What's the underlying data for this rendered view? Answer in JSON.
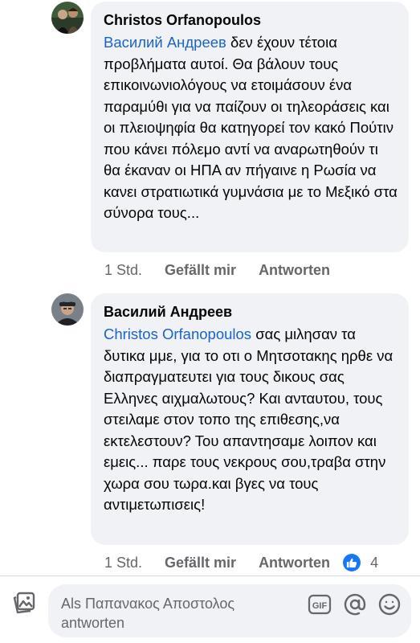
{
  "comments": [
    {
      "author": "Christos Orfanopoulos",
      "mention": "Василий Андреев",
      "text": " δεν έχουν τέτοια προβλήματα αυτοί.  Θα βάλουν τους επικοινωνιολόγους να ετοιμάσουν ένα παραμύθι για να παίζουν οι τηλεοράσεις και οι πλειοψηφία θα κατηγορεί τον κακό Πούτιν που κάνει πόλεμο αντί να αναρωτηθούν τι θα έκαναν οι ΗΠΑ αν πήγαινε η Ρωσία να κανει στρατιωτικά γυμνάσια με το Μεξικό στα σύνορα τους...",
      "time": "1 Std.",
      "like_label": "Gefällt mir",
      "reply_label": "Antworten"
    },
    {
      "author": "Василий Андреев",
      "mention": "Christos Orfanopoulos",
      "text": " σας μιλησαν τα δυτικα μμε, για το οτι ο Μητσοτακης ηρθε να διαπραγματευτει για τους δικους σας Ελληνες αιχμαλωτους? Και ανταυτου, τους στειλαμε στον τοπο της επιθεσης,να εκτελεστουν? Του απαντησαμε λοιπον και εμεις... παρε τους νεκρους σου,τραβα στην χωρα σου τωρα.και βγες να τους αντιμετωπισεις!",
      "time": "1 Std.",
      "like_label": "Gefällt mir",
      "reply_label": "Antworten",
      "reaction_icon": "like-icon",
      "reaction_count": "4"
    }
  ],
  "composer": {
    "placeholder": "Als Παπανακος Αποστολος antworten",
    "gif_label": "GIF"
  },
  "colors": {
    "mention": "#1b64c7",
    "bubble": "#f0f2f5",
    "like": "#1877f2"
  }
}
